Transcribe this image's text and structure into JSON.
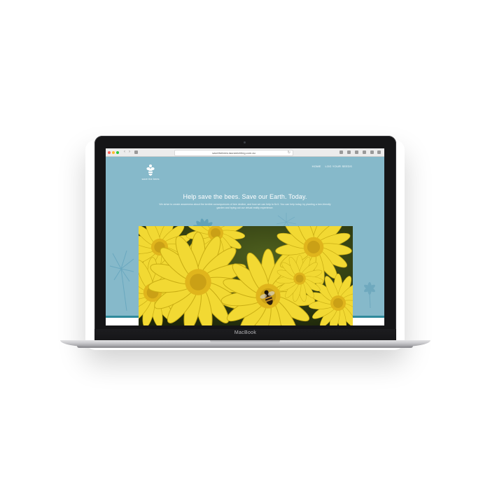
{
  "device": {
    "brand_label": "MacBook"
  },
  "browser": {
    "url": "savethebees.lauramichling.com.au",
    "back_icon": "chevron-left-icon",
    "forward_icon": "chevron-right-icon",
    "reload_icon": "reload-icon"
  },
  "site": {
    "logo_text": "save the bees",
    "nav": [
      {
        "label": "HOME"
      },
      {
        "label": "LOG YOUR SEEDS"
      }
    ],
    "hero_title": "Help save the bees. Save our Earth. Today.",
    "hero_text": "We strive to create awareness about the terrible consequences of bee decline, and how we can help to fix it. You can help today, by planting a bee-friendly garden and trying out our virtual reality experience.",
    "colors": {
      "background": "#86b9ca",
      "accent": "#2f8a9c",
      "flower_yellow": "#f2d933"
    }
  }
}
